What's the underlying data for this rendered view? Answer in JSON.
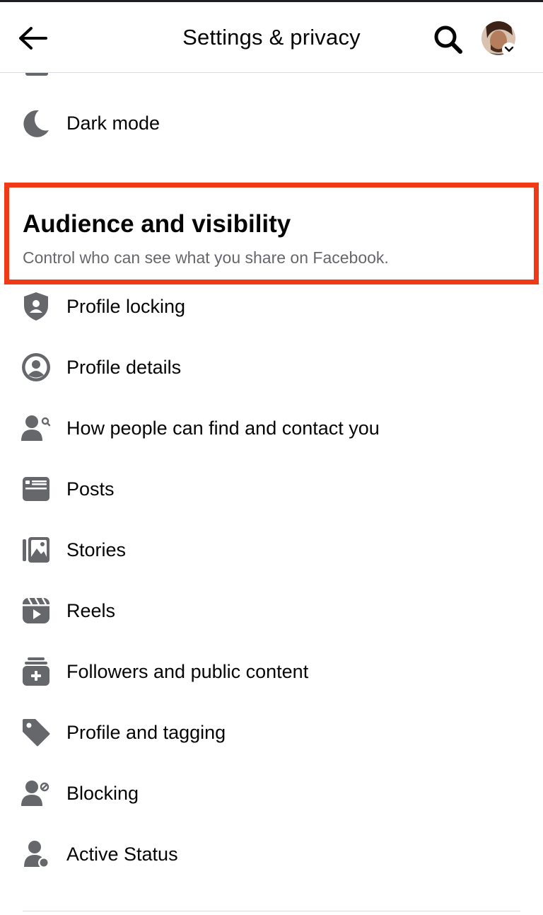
{
  "header": {
    "title": "Settings & privacy",
    "back_icon": "arrow-left-icon",
    "search_icon": "search-icon",
    "avatar": "profile-avatar"
  },
  "dark_mode": {
    "label": "Dark mode",
    "icon": "moon-icon"
  },
  "section": {
    "title": "Audience and visibility",
    "subtitle": "Control who can see what you share on Facebook.",
    "highlight_color": "#f03a17"
  },
  "items": [
    {
      "label": "Profile locking",
      "icon": "shield-user-icon"
    },
    {
      "label": "Profile details",
      "icon": "user-circle-icon"
    },
    {
      "label": "How people can find and contact you",
      "icon": "person-search-icon"
    },
    {
      "label": "Posts",
      "icon": "posts-icon"
    },
    {
      "label": "Stories",
      "icon": "stories-icon"
    },
    {
      "label": "Reels",
      "icon": "reels-icon"
    },
    {
      "label": "Followers and public content",
      "icon": "followers-icon"
    },
    {
      "label": "Profile and tagging",
      "icon": "tag-icon"
    },
    {
      "label": "Blocking",
      "icon": "block-user-icon"
    },
    {
      "label": "Active Status",
      "icon": "active-status-icon"
    }
  ],
  "colors": {
    "icon_gray": "#65676b",
    "text": "#050505",
    "secondary_text": "#65676b"
  }
}
